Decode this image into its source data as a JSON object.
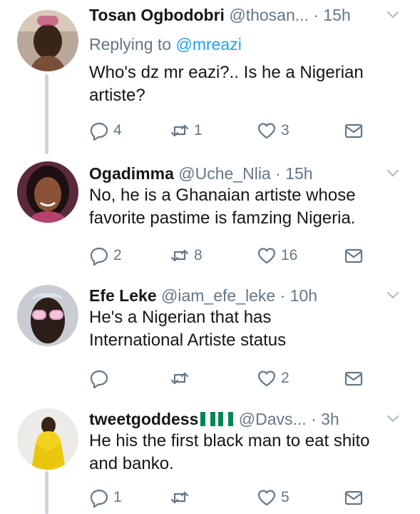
{
  "tweets": [
    {
      "name": "Tosan Ogbodobri",
      "handle": "@thosan...",
      "dot": "·",
      "time": "15h",
      "replying_prefix": "Replying to",
      "replying_to": "@mreazi",
      "text": "Who's dz mr eazi?..  Is he a Nigerian artiste?",
      "replies": "4",
      "retweets": "1",
      "likes": "3"
    },
    {
      "name": "Ogadimma",
      "handle": "@Uche_Nlia",
      "dot": "·",
      "time": "15h",
      "text": "No, he is a Ghanaian artiste whose favorite pastime is famzing Nigeria.",
      "replies": "2",
      "retweets": "8",
      "likes": "16"
    },
    {
      "name": "Efe Leke",
      "handle": "@iam_efe_leke",
      "dot": "·",
      "time": "10h",
      "text": "He's a Nigerian that has International Artiste status",
      "replies": "",
      "retweets": "",
      "likes": "2"
    },
    {
      "name": "tweetgoddess",
      "handle": "@Davs...",
      "dot": "·",
      "time": "3h",
      "text": "He his the first black man to eat shito and banko.",
      "replies": "1",
      "retweets": "",
      "likes": "5"
    }
  ],
  "icons": {
    "reply": "reply-icon",
    "retweet": "retweet-icon",
    "like": "heart-icon",
    "dm": "envelope-icon",
    "more": "chevron-down-icon"
  },
  "colors": {
    "text": "#14171a",
    "muted": "#657786",
    "link": "#1da1f2",
    "thread_line": "#ccd6dd",
    "flag_green": "#008751"
  }
}
